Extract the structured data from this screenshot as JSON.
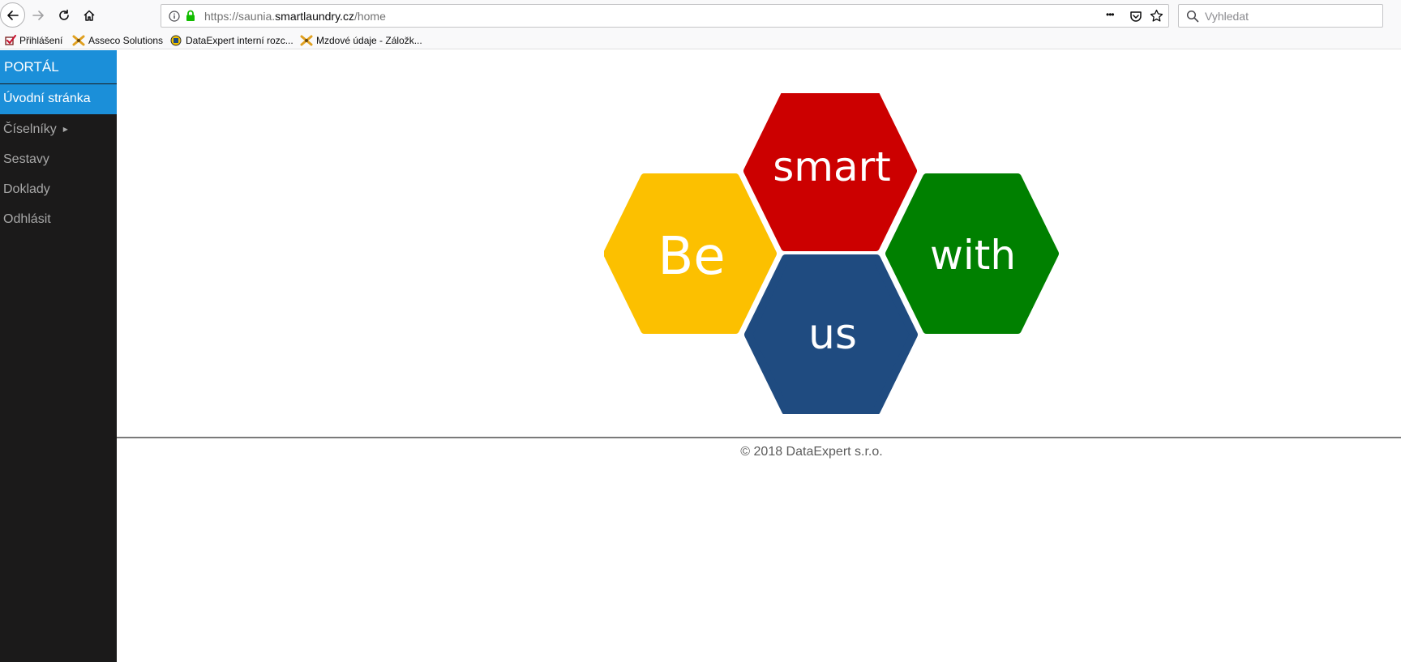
{
  "browser": {
    "url_prefix": "https://saunia.",
    "url_domain": "smartlaundry.cz",
    "url_path": "/home",
    "search_placeholder": "Vyhledat",
    "menu_dots": "•••"
  },
  "bookmarks": [
    {
      "label": "Přihlášení"
    },
    {
      "label": "Asseco Solutions"
    },
    {
      "label": "DataExpert interní rozc..."
    },
    {
      "label": "Mzdové údaje - Záložk..."
    }
  ],
  "sidebar": {
    "title": "PORTÁL",
    "active_item": "Úvodní stránka",
    "items": [
      {
        "label": "Číselníky",
        "has_submenu": true
      },
      {
        "label": "Sestavy"
      },
      {
        "label": "Doklady"
      },
      {
        "label": "Odhlásit"
      }
    ]
  },
  "logo": {
    "words": [
      "Be",
      "smart",
      "with",
      "us"
    ],
    "colors": {
      "be": "#fcc000",
      "smart": "#cc0000",
      "with": "#008000",
      "us": "#1f4b80"
    }
  },
  "footer": {
    "text": "© 2018 DataExpert s.r.o."
  },
  "colors": {
    "sidebar_bg": "#1b1a1a",
    "accent": "#1b8fd9"
  }
}
